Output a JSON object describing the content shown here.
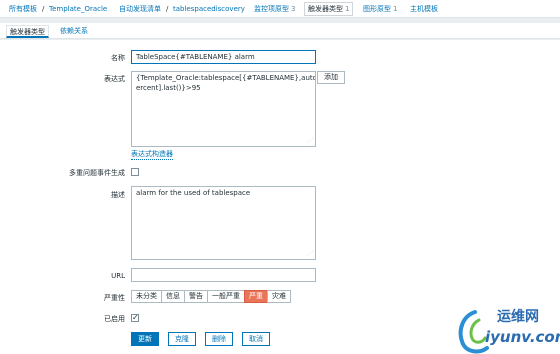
{
  "breadcrumb": {
    "all_templates": "所有模板",
    "separator": "/",
    "template": "Template_Oracle",
    "discovery_list": "自动发现清单",
    "discovery_rule": "tablespacediscovery",
    "items": {
      "label": "监控项原型",
      "count": "3"
    },
    "triggers": {
      "label": "触发器类型",
      "count": "1"
    },
    "graphs": {
      "label": "图形原型",
      "count": "1"
    },
    "host_templates": "主机模板"
  },
  "tabs": [
    {
      "label": "触发器类型",
      "active": true
    },
    {
      "label": "依赖关系",
      "active": false
    }
  ],
  "form": {
    "name": {
      "label": "名称",
      "value": "TableSpace{#TABLENAME} alarm"
    },
    "expression": {
      "label": "表达式",
      "line1": "{Template_Oracle:tablespace[{#TABLENAME},autop",
      "line2": "ercent].last()}>95",
      "add_button": "添加",
      "builder_link": "表达式构造器"
    },
    "multiple_events": {
      "label": "多重问题事件生成",
      "checked": false
    },
    "description": {
      "label": "描述",
      "value": "alarm for the used of tablespace"
    },
    "url": {
      "label": "URL",
      "value": ""
    },
    "severity": {
      "label": "严重性",
      "options": [
        "未分类",
        "信息",
        "警告",
        "一般严重",
        "严重",
        "灾难"
      ],
      "selected": "严重",
      "selected_color": "#e97659"
    },
    "enabled": {
      "label": "已启用",
      "checked": true
    }
  },
  "actions": {
    "update": "更新",
    "clone": "克隆",
    "delete": "删除",
    "cancel": "取消"
  },
  "watermark": {
    "cn": "运维网",
    "en": "iyunv.com"
  }
}
